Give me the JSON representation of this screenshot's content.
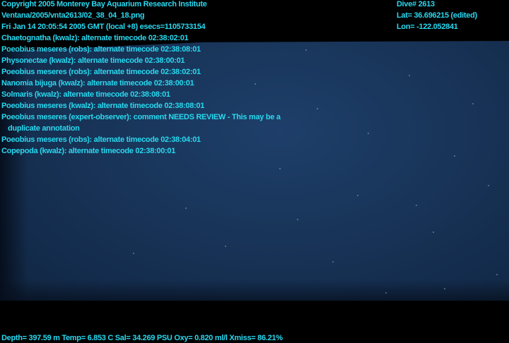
{
  "header": {
    "copyright": "Copyright 2005 Monterey Bay Aquarium Research Institute",
    "filename": "Ventana/2005/vnta2613/02_38_04_18.png",
    "timestamp": "Fri Jan 14 20:05:54 2005 GMT (local +8)  esecs=1105733154",
    "dive": "Dive# 2613",
    "lat": "Lat= 36.696215 (edited)",
    "lon": "Lon= -122.052841"
  },
  "annotations": [
    "Chaetognatha (kwalz): alternate timecode 02:38:02:01",
    "Poeobius meseres (robs): alternate timecode 02:38:08:01",
    "Physonectae (kwalz): alternate timecode 02:38:00:01",
    "Poeobius meseres (robs): alternate timecode 02:38:02:01",
    "Nanomia bijuga (kwalz): alternate timecode 02:38:00:01",
    "Solmaris (kwalz): alternate timecode 02:38:08:01",
    "Poeobius meseres (kwalz): alternate timecode 02:38:08:01",
    "Poeobius meseres (expert-observer): comment NEEDS REVIEW - This may be a",
    "duplicate annotation",
    "Poeobius meseres (robs): alternate timecode 02:38:04:01",
    "Copepoda (kwalz): alternate timecode 02:38:00:01"
  ],
  "footer": {
    "telemetry": "Depth= 397.59 m  Temp= 6.853 C  Sal= 34.269 PSU  Oxy= 0.820 ml/l  Xmiss= 86.21%"
  },
  "colors": {
    "overlay_text": "#29d8ef",
    "water": "#183458",
    "background": "#000000"
  }
}
